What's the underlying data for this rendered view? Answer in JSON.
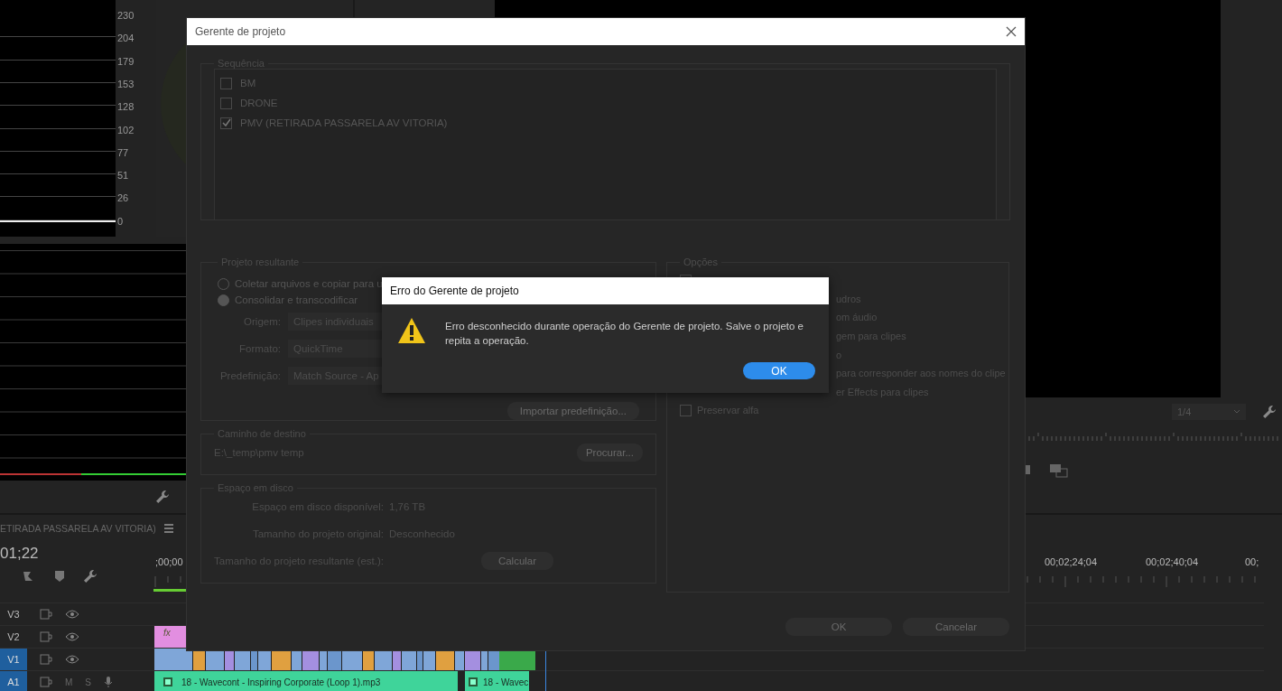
{
  "scopes": {
    "scale": [
      "230",
      "204",
      "179",
      "153",
      "128",
      "102",
      "77",
      "51",
      "26",
      "0"
    ]
  },
  "program_monitor": {
    "zoom": "1/4"
  },
  "timeline": {
    "sequence_name": "ETIRADA PASSARELA AV VITORIA)",
    "timecode": "01;22",
    "ruler": [
      {
        "label": ";00;00"
      },
      {
        "label": "00;02;24;04"
      },
      {
        "label": "00;02;40;04"
      },
      {
        "label": "00;"
      }
    ],
    "tracks": [
      {
        "label": "V3",
        "kind": "video",
        "selected": false
      },
      {
        "label": "V2",
        "kind": "video",
        "selected": false,
        "clips": [
          {
            "kind": "effect",
            "label": "fx"
          }
        ]
      },
      {
        "label": "V1",
        "kind": "video",
        "selected": true,
        "clips": [
          {
            "kind": "strip"
          }
        ]
      },
      {
        "label": "A1",
        "kind": "audio",
        "selected": true,
        "mute": "M",
        "solo": "S",
        "clips": [
          {
            "kind": "audio",
            "label": "18 - Wavecont - Inspiring Corporate (Loop 1).mp3"
          },
          {
            "kind": "audio",
            "label": "18 - Wavec"
          }
        ]
      }
    ]
  },
  "project_manager": {
    "title": "Gerente de projeto",
    "sequence": {
      "legend": "Sequência",
      "items": [
        {
          "label": "BM",
          "checked": false
        },
        {
          "label": "DRONE",
          "checked": false
        },
        {
          "label": "PMV (RETIRADA PASSARELA AV VITORIA)",
          "checked": true
        }
      ]
    },
    "resulting_project": {
      "legend": "Projeto resultante",
      "modes": [
        {
          "label": "Coletar arquivos e copiar para u",
          "selected": false
        },
        {
          "label": "Consolidar e transcodificar",
          "selected": true
        }
      ],
      "fields": [
        {
          "label": "Origem:",
          "value": "Clipes individuais"
        },
        {
          "label": "Formato:",
          "value": "QuickTime"
        },
        {
          "label": "Predefinição:",
          "value": "Match Source - Ap"
        }
      ],
      "import_button": "Importar predefinição..."
    },
    "destination": {
      "legend": "Caminho de destino",
      "path": "E:\\_temp\\pmv temp",
      "browse_button": "Procurar..."
    },
    "disk_space": {
      "legend": "Espaço em disco",
      "rows": [
        {
          "kind": "value",
          "label": "Espaço em disco disponível:",
          "value": "1,76 TB"
        },
        {
          "kind": "value",
          "label": "Tamanho do projeto original:",
          "value": "Desconhecido"
        },
        {
          "kind": "button",
          "label": "Tamanho do projeto resultante (est.):",
          "button": "Calcular"
        }
      ]
    },
    "options": {
      "legend": "Opções",
      "items": [
        {
          "kind": "checkbox",
          "checked": false
        },
        {
          "kind": "fragment",
          "label": "udros"
        },
        {
          "kind": "fragment",
          "label": "om áudio"
        },
        {
          "kind": "fragment",
          "label": "gem para clipes"
        },
        {
          "kind": "fragment",
          "label": "o"
        },
        {
          "kind": "fragment",
          "label": "para corresponder aos nomes do clipe"
        },
        {
          "kind": "fragment",
          "label": "er Effects para clipes"
        },
        {
          "kind": "checkbox",
          "label": "Preservar alfa",
          "checked": false
        }
      ]
    },
    "buttons": [
      "OK",
      "Cancelar"
    ]
  },
  "error_dialog": {
    "title": "Erro do Gerente de projeto",
    "message": "Erro desconhecido durante operação do Gerente de projeto. Salve o projeto e repita a operação.",
    "button": "OK"
  }
}
